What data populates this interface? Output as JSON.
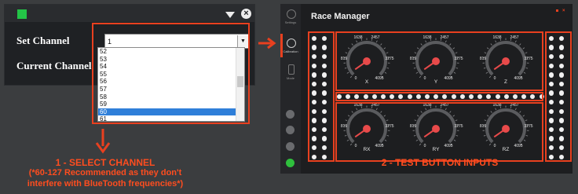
{
  "dialog": {
    "set_channel_label": "Set Channel",
    "current_channel_label": "Current Channel",
    "selected_value": "1",
    "options": [
      "52",
      "53",
      "54",
      "55",
      "56",
      "57",
      "58",
      "59",
      "60",
      "61"
    ],
    "highlighted_option": "60"
  },
  "annotation1": {
    "line1": "1 - SELECT CHANNEL",
    "line2": "(*60-127 Recommended as they don't",
    "line3": "interfere with BlueTooth frequencies*)"
  },
  "race_manager": {
    "title": "Race Manager",
    "sidebar": [
      "Settings",
      "Calibration",
      "Mode"
    ],
    "gauges": [
      {
        "label": "X",
        "tick_top_left": "1638",
        "tick_top_right": "2457",
        "tick_left": "819",
        "tick_right": "3275",
        "tick_bottom_left": "0",
        "tick_bottom_right": "4095"
      },
      {
        "label": "Y",
        "tick_top_left": "1638",
        "tick_top_right": "2457",
        "tick_left": "819",
        "tick_right": "3275",
        "tick_bottom_left": "0",
        "tick_bottom_right": "4095"
      },
      {
        "label": "Z",
        "tick_top_left": "1638",
        "tick_top_right": "2457",
        "tick_left": "819",
        "tick_right": "3275",
        "tick_bottom_left": "0",
        "tick_bottom_right": "4095"
      },
      {
        "label": "RX",
        "tick_top_left": "1638",
        "tick_top_right": "2457",
        "tick_left": "819",
        "tick_right": "3275",
        "tick_bottom_left": "0",
        "tick_bottom_right": "4095"
      },
      {
        "label": "RY",
        "tick_top_left": "1638",
        "tick_top_right": "2457",
        "tick_left": "819",
        "tick_right": "3275",
        "tick_bottom_left": "0",
        "tick_bottom_right": "4095"
      },
      {
        "label": "RZ",
        "tick_top_left": "1638",
        "tick_top_right": "2457",
        "tick_left": "819",
        "tick_right": "3275",
        "tick_bottom_left": "0",
        "tick_bottom_right": "4095"
      }
    ]
  },
  "annotation2": {
    "text": "2 - TEST BUTTON INPUTS"
  },
  "colors": {
    "accent": "#e8401f",
    "green": "#23c447",
    "needle": "#e84a4a",
    "selection": "#2f7fd9"
  }
}
